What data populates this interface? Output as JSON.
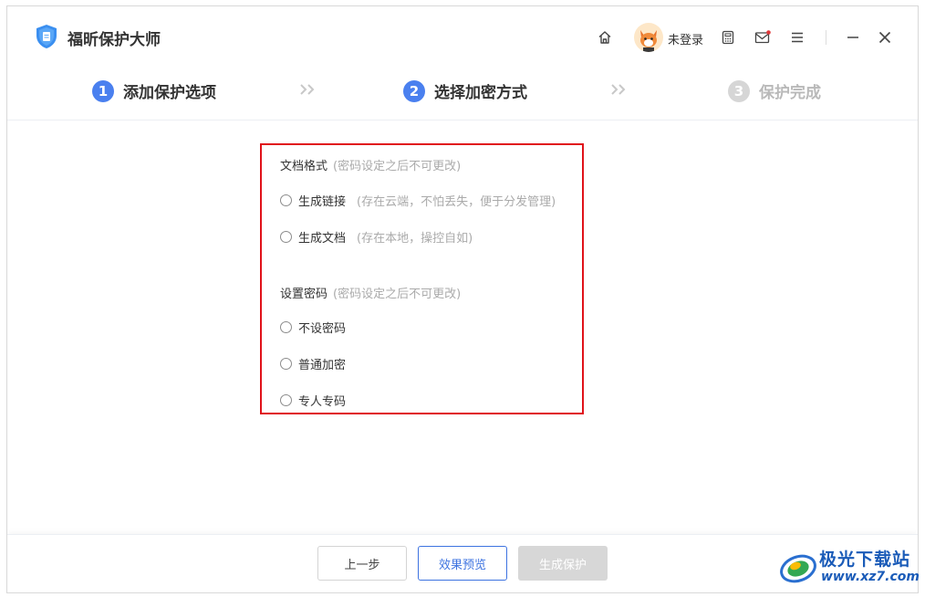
{
  "app": {
    "title": "福昕保护大师"
  },
  "header": {
    "login_status": "未登录"
  },
  "steps": [
    {
      "number": "1",
      "label": "添加保护选项",
      "state": "active"
    },
    {
      "number": "2",
      "label": "选择加密方式",
      "state": "active"
    },
    {
      "number": "3",
      "label": "保护完成",
      "state": "inactive"
    }
  ],
  "format_section": {
    "title": "文档格式",
    "hint": "(密码设定之后不可更改)",
    "options": [
      {
        "label": "生成链接",
        "hint": "(存在云端，不怕丢失，便于分发管理)",
        "selected": false
      },
      {
        "label": "生成文档",
        "hint": "(存在本地，操控自如)",
        "selected": false
      }
    ]
  },
  "password_section": {
    "title": "设置密码",
    "hint": "(密码设定之后不可更改)",
    "options": [
      {
        "label": "不设密码",
        "selected": false
      },
      {
        "label": "普通加密",
        "selected": false
      },
      {
        "label": "专人专码",
        "selected": false
      }
    ]
  },
  "footer": {
    "prev_label": "上一步",
    "preview_label": "效果预览",
    "generate_label": "生成保护"
  },
  "watermark": {
    "title": "极光下载站",
    "url": "www.xz7.com"
  },
  "colors": {
    "accent": "#4a80ef",
    "highlight_border": "#e0121a",
    "disabled": "#d7d7d7"
  },
  "icons": [
    "shield-logo-icon",
    "home-icon",
    "calculator-icon",
    "mail-icon",
    "menu-icon",
    "minimize-icon",
    "close-icon",
    "double-chevron-icon"
  ]
}
